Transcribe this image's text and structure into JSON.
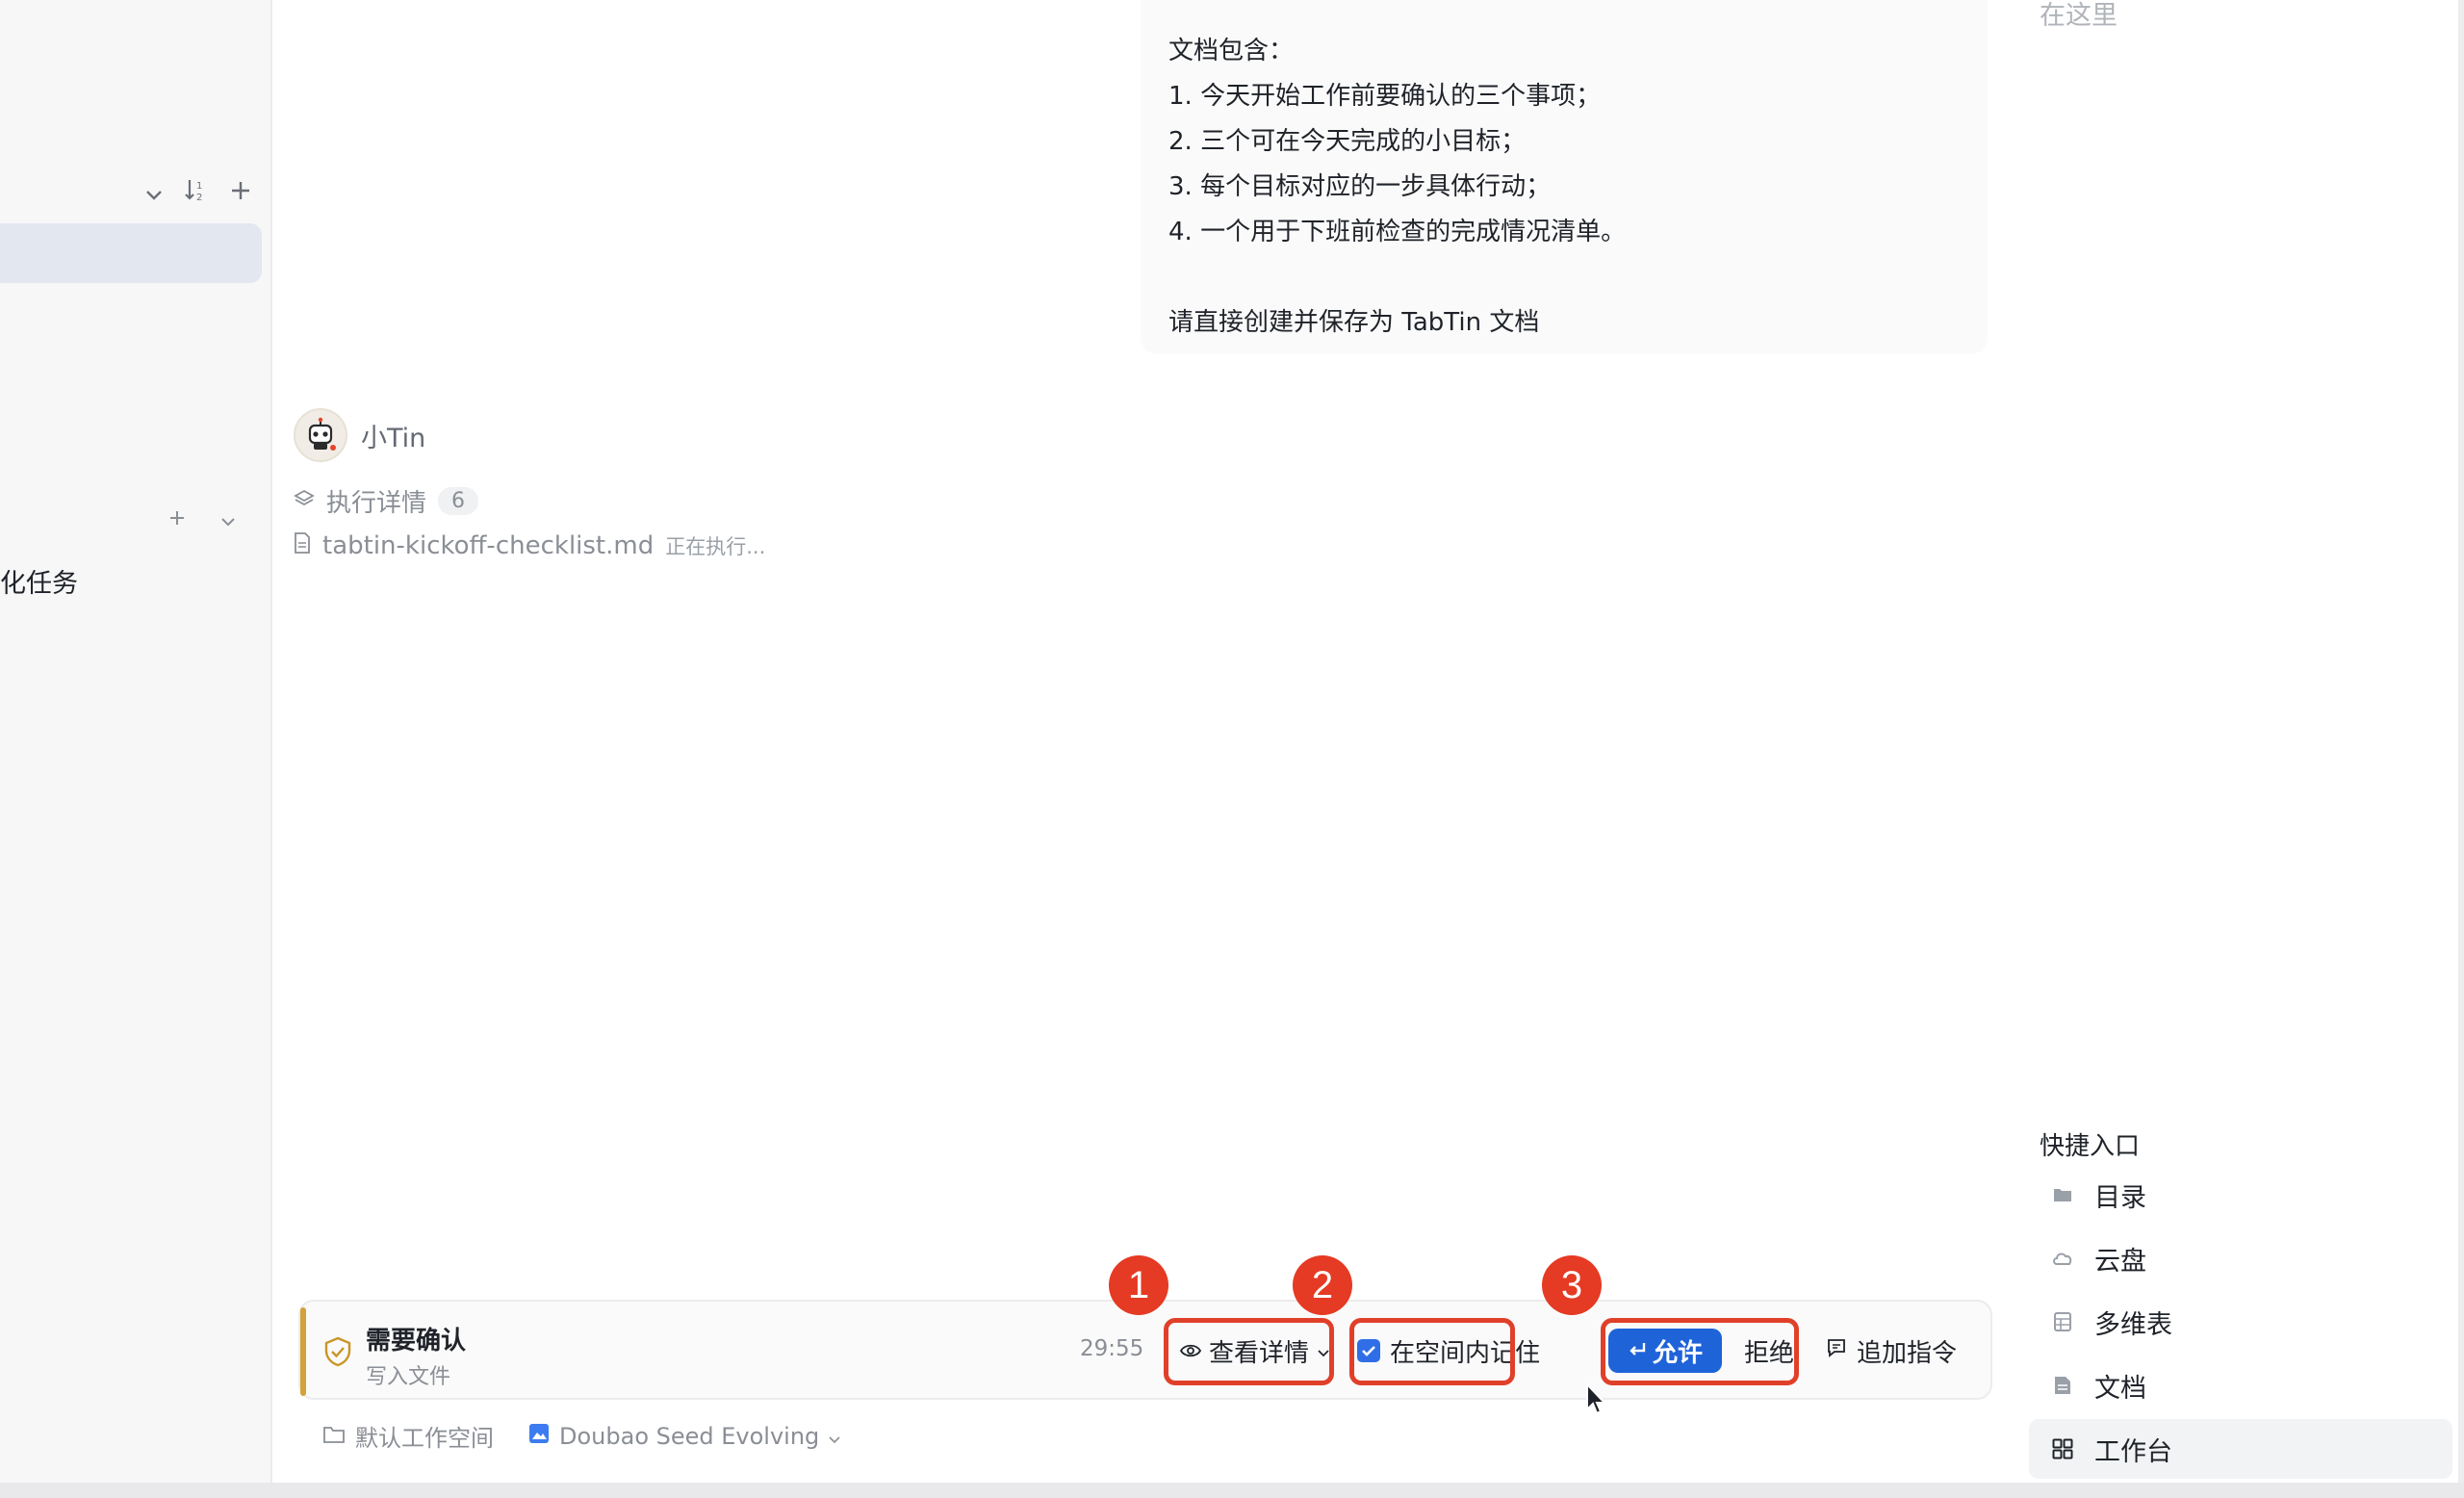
{
  "sidebar": {
    "task_label": "化任务"
  },
  "chat": {
    "user_message": {
      "lines": [
        "文档包含：",
        "1. 今天开始工作前要确认的三个事项；",
        "2. 三个可在今天完成的小目标；",
        "3. 每个目标对应的一步具体行动；",
        "4. 一个用于下班前检查的完成情况清单。",
        "请直接创建并保存为 TabTin 文档"
      ]
    },
    "bot_name": "小Tin",
    "exec_label": "执行详情",
    "exec_count": "6",
    "file_name": "tabtin-kickoff-checklist.md",
    "file_status": "正在执行..."
  },
  "confirm": {
    "title": "需要确认",
    "subtitle": "写入文件",
    "timer": "29:55",
    "view_detail_label": "查看详情",
    "remember_label": "在空间内记住",
    "allow_label": "允许",
    "reject_label": "拒绝",
    "append_label": "追加指令",
    "markers": [
      "1",
      "2",
      "3"
    ]
  },
  "bottom_meta": {
    "workspace": "默认工作空间",
    "model": "Doubao Seed Evolving"
  },
  "right_panel": {
    "top_hint": "在这里",
    "title": "快捷入口",
    "items": [
      {
        "label": "目录",
        "icon": "folder-icon"
      },
      {
        "label": "云盘",
        "icon": "cloud-icon"
      },
      {
        "label": "多维表",
        "icon": "table-icon"
      },
      {
        "label": "文档",
        "icon": "doc-icon"
      },
      {
        "label": "工作台",
        "icon": "grid-icon"
      }
    ]
  },
  "colors": {
    "accent_blue": "#1f63d9",
    "highlight_red": "#e0402a",
    "warning_gold": "#d4a23a"
  }
}
